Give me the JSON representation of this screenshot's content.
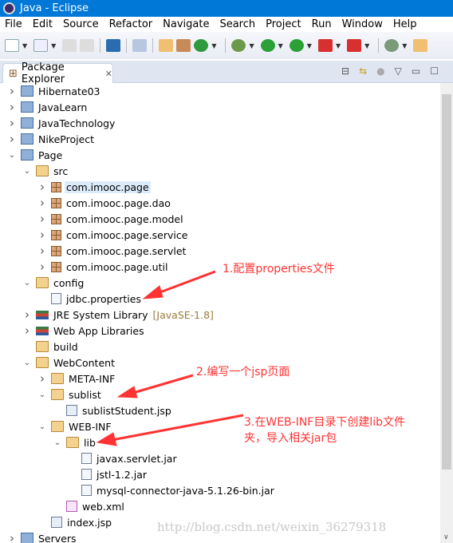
{
  "window": {
    "title": "Java - Eclipse"
  },
  "menu": [
    "File",
    "Edit",
    "Source",
    "Refactor",
    "Navigate",
    "Search",
    "Project",
    "Run",
    "Window",
    "Help"
  ],
  "view": {
    "tab_label": "Package Explorer"
  },
  "tree": [
    {
      "label": "Hibernate03",
      "level": 0,
      "state": "collapsed",
      "icon": "project-icon"
    },
    {
      "label": "JavaLearn",
      "level": 0,
      "state": "collapsed",
      "icon": "project-icon"
    },
    {
      "label": "JavaTechnology",
      "level": 0,
      "state": "collapsed",
      "icon": "project-icon"
    },
    {
      "label": "NikeProject",
      "level": 0,
      "state": "collapsed",
      "icon": "project-icon"
    },
    {
      "label": "Page",
      "level": 0,
      "state": "expanded",
      "icon": "project-icon"
    },
    {
      "label": "src",
      "level": 1,
      "state": "expanded",
      "icon": "source-folder-icon"
    },
    {
      "label": "com.imooc.page",
      "level": 2,
      "state": "collapsed",
      "icon": "package-icon",
      "selected": true
    },
    {
      "label": "com.imooc.page.dao",
      "level": 2,
      "state": "collapsed",
      "icon": "package-icon"
    },
    {
      "label": "com.imooc.page.model",
      "level": 2,
      "state": "collapsed",
      "icon": "package-icon"
    },
    {
      "label": "com.imooc.page.service",
      "level": 2,
      "state": "collapsed",
      "icon": "package-icon"
    },
    {
      "label": "com.imooc.page.servlet",
      "level": 2,
      "state": "collapsed",
      "icon": "package-icon"
    },
    {
      "label": "com.imooc.page.util",
      "level": 2,
      "state": "collapsed",
      "icon": "package-icon"
    },
    {
      "label": "config",
      "level": 1,
      "state": "expanded",
      "icon": "source-folder-icon"
    },
    {
      "label": "jdbc.properties",
      "level": 2,
      "state": "leaf",
      "icon": "properties-file-icon"
    },
    {
      "label": "JRE System Library",
      "level": 1,
      "state": "collapsed",
      "icon": "library-icon",
      "decoration": "[JavaSE-1.8]"
    },
    {
      "label": "Web App Libraries",
      "level": 1,
      "state": "collapsed",
      "icon": "library-icon"
    },
    {
      "label": "build",
      "level": 1,
      "state": "leaf",
      "icon": "folder-icon"
    },
    {
      "label": "WebContent",
      "level": 1,
      "state": "expanded",
      "icon": "folder-icon"
    },
    {
      "label": "META-INF",
      "level": 2,
      "state": "collapsed",
      "icon": "folder-icon"
    },
    {
      "label": "sublist",
      "level": 2,
      "state": "expanded",
      "icon": "folder-icon"
    },
    {
      "label": "sublistStudent.jsp",
      "level": 3,
      "state": "leaf",
      "icon": "jsp-file-icon"
    },
    {
      "label": "WEB-INF",
      "level": 2,
      "state": "expanded",
      "icon": "folder-icon"
    },
    {
      "label": "lib",
      "level": 3,
      "state": "expanded",
      "icon": "folder-icon"
    },
    {
      "label": "javax.servlet.jar",
      "level": 4,
      "state": "leaf",
      "icon": "jar-file-icon"
    },
    {
      "label": "jstl-1.2.jar",
      "level": 4,
      "state": "leaf",
      "icon": "jar-file-icon"
    },
    {
      "label": "mysql-connector-java-5.1.26-bin.jar",
      "level": 4,
      "state": "leaf",
      "icon": "jar-file-icon"
    },
    {
      "label": "web.xml",
      "level": 3,
      "state": "leaf",
      "icon": "xml-file-icon"
    },
    {
      "label": "index.jsp",
      "level": 2,
      "state": "leaf",
      "icon": "jsp-file-icon"
    },
    {
      "label": "Servers",
      "level": 0,
      "state": "collapsed",
      "icon": "project-icon"
    }
  ],
  "annotations": {
    "note1": "1.配置properties文件",
    "note2": "2.编写一个jsp页面",
    "note3_line1": "3.在WEB-INF目录下创建lib文件",
    "note3_line2": "夹，导入相关jar包",
    "color": "#ff3333"
  },
  "watermark": "http://blog.csdn.net/weixin_36279318"
}
